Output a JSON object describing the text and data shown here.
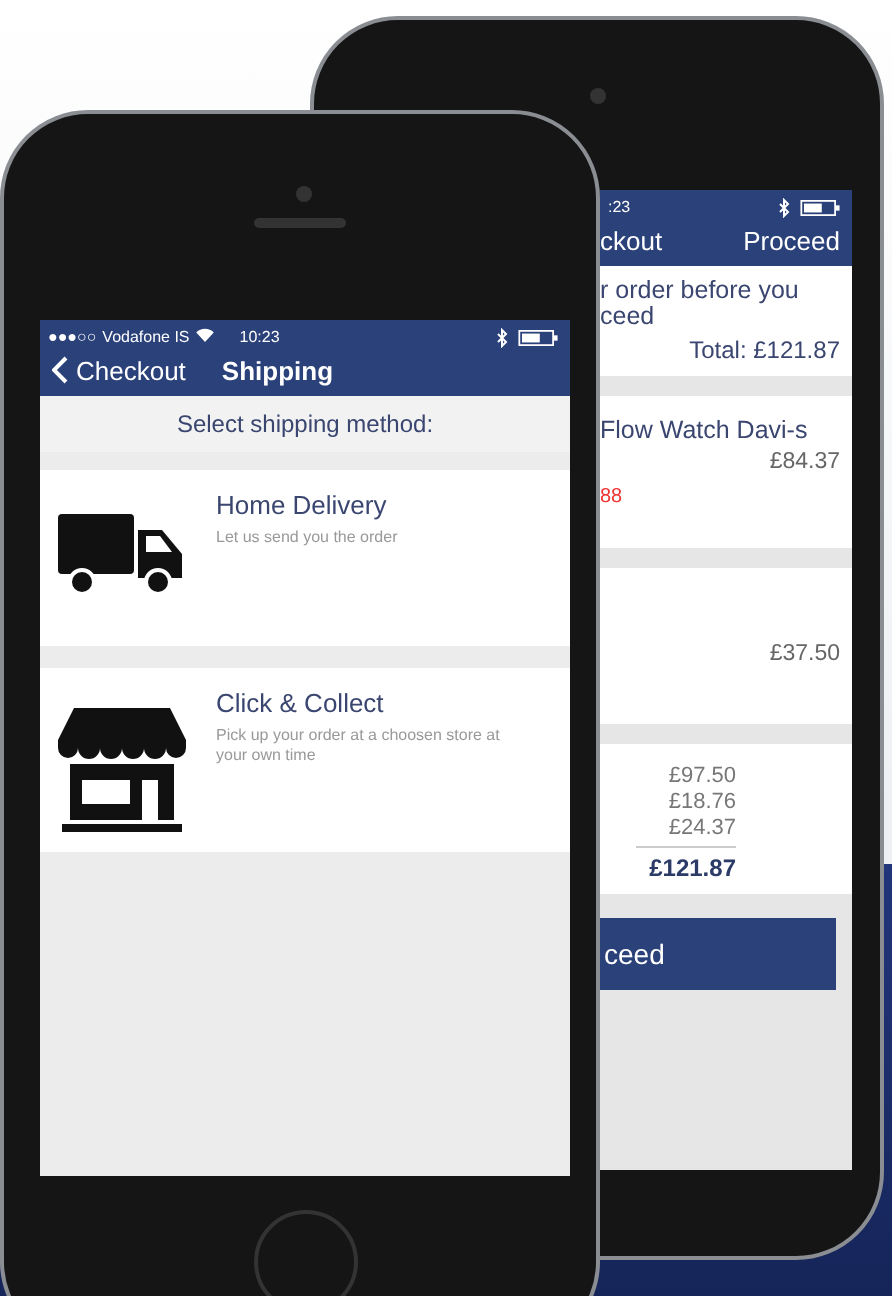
{
  "back_phone": {
    "status_bar": {
      "time": ":23"
    },
    "nav": {
      "back_label": "ckout",
      "action": "Proceed"
    },
    "summary": {
      "lines": [
        "r order before you",
        "ceed"
      ],
      "total": "Total: £121.87"
    },
    "items": [
      {
        "title": "Flow Watch Davi-s",
        "price": "£84.37",
        "note": "88"
      },
      {
        "price": "£37.50"
      }
    ],
    "breakdown": [
      "£97.50",
      "£18.76",
      "£24.37"
    ],
    "grand_total": "£121.87",
    "button": "ceed"
  },
  "front_phone": {
    "status_bar": {
      "signal": "●●●○○",
      "carrier": "Vodafone IS",
      "time": "10:23"
    },
    "nav": {
      "back_label": "Checkout",
      "title": "Shipping"
    },
    "header": "Select shipping method:",
    "options": [
      {
        "kind": "truck",
        "title": "Home Delivery",
        "subtitle": "Let us send you the order"
      },
      {
        "kind": "store",
        "title": "Click & Collect",
        "subtitle": "Pick up your order at a choosen store at your own time"
      }
    ]
  }
}
